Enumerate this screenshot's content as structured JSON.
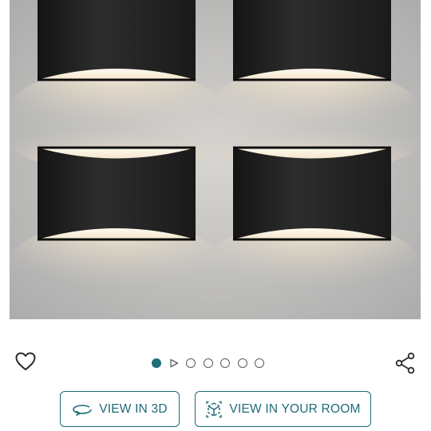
{
  "product": {
    "image_alt_icon": "wall-sconce-photo"
  },
  "actions": {
    "wishlist_icon": "heart-outline-icon",
    "share_icon": "share-icon"
  },
  "carousel": {
    "total_slides": 7,
    "active_index": 0,
    "video_slide_index": 1
  },
  "buttons": {
    "view_3d_label": "VIEW IN 3D",
    "view_room_label": "VIEW IN YOUR ROOM"
  },
  "colors": {
    "accent": "#1e6b78",
    "active_dot": "#1f6f7a"
  }
}
